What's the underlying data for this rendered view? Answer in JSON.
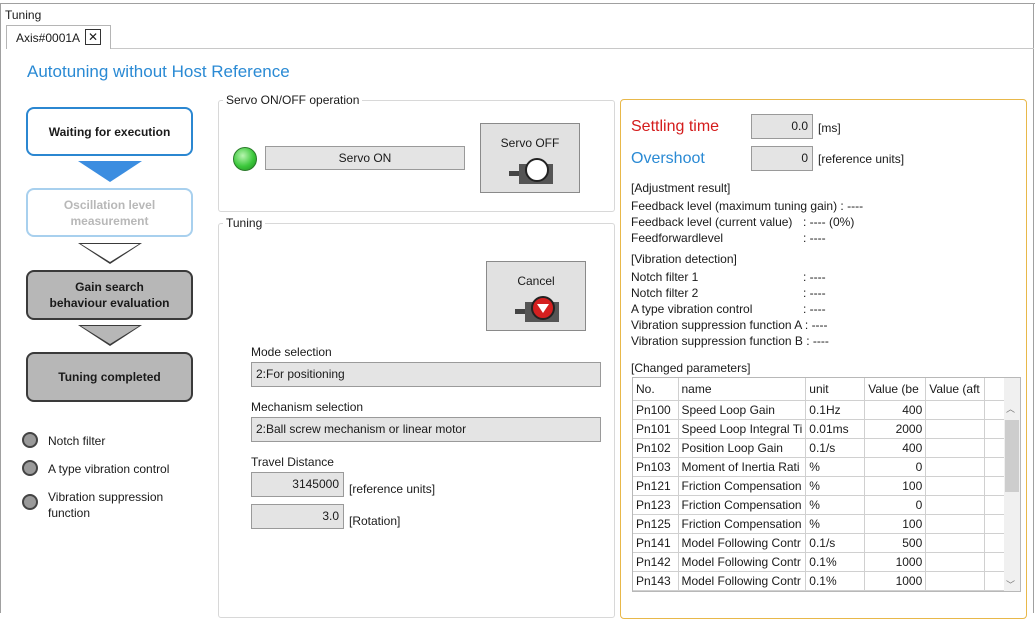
{
  "window": {
    "title": "Tuning",
    "tab_label": "Axis#0001A",
    "tab_close": "✕"
  },
  "page_title": "Autotuning without Host Reference",
  "flow": {
    "steps": [
      "Waiting for execution",
      "Oscillation level\nmeasurement",
      "Gain search\nbehaviour evaluation",
      "Tuning completed"
    ]
  },
  "legend": [
    "Notch filter",
    "A type vibration control",
    "Vibration suppression\nfunction"
  ],
  "servo": {
    "group_label": "Servo ON/OFF operation",
    "status": "Servo ON",
    "status_color": "#3cc83c",
    "button_label": "Servo OFF"
  },
  "tuning": {
    "group_label": "Tuning",
    "cancel_label": "Cancel",
    "mode_label": "Mode selection",
    "mode_value": "2:For positioning",
    "mechanism_label": "Mechanism selection",
    "mechanism_value": "2:Ball screw mechanism or linear motor",
    "travel_label": "Travel Distance",
    "travel_value": "3145000",
    "travel_unit": "[reference units]",
    "rotation_value": "3.0",
    "rotation_unit": "[Rotation]"
  },
  "result": {
    "settling_label": "Settling time",
    "settling_value": "0.0",
    "settling_unit": "[ms]",
    "overshoot_label": "Overshoot",
    "overshoot_value": "0",
    "overshoot_unit": "[reference units]",
    "adjustment_heading": "[Adjustment result]",
    "adjustment_lines": [
      "Feedback level (maximum tuning gain) : ----",
      "Feedback level (current value)     : ---- (0%)",
      "Feedforwardlevel                   : ----"
    ],
    "vibration_heading": "[Vibration detection]",
    "vibration_lines": [
      "Notch filter 1                    : ----",
      "Notch filter 2                    : ----",
      "A type vibration control          : ----",
      "Vibration suppression function A : ----",
      "Vibration suppression function B : ----"
    ],
    "changed_heading": "[Changed parameters]"
  },
  "table": {
    "headers": [
      "No.",
      "name",
      "unit",
      "Value (be",
      "Value (aft",
      ""
    ],
    "rows": [
      [
        "Pn100",
        "Speed Loop Gain",
        "0.1Hz",
        "400",
        "",
        ""
      ],
      [
        "Pn101",
        "Speed Loop Integral Ti",
        "0.01ms",
        "2000",
        "",
        ""
      ],
      [
        "Pn102",
        "Position Loop Gain",
        "0.1/s",
        "400",
        "",
        ""
      ],
      [
        "Pn103",
        "Moment of Inertia Rati",
        "%",
        "0",
        "",
        ""
      ],
      [
        "Pn121",
        "Friction Compensation",
        "%",
        "100",
        "",
        ""
      ],
      [
        "Pn123",
        "Friction Compensation",
        "%",
        "0",
        "",
        ""
      ],
      [
        "Pn125",
        "Friction Compensation",
        "%",
        "100",
        "",
        ""
      ],
      [
        "Pn141",
        "Model Following Contr",
        "0.1/s",
        "500",
        "",
        ""
      ],
      [
        "Pn142",
        "Model Following Contr",
        "0.1%",
        "1000",
        "",
        ""
      ],
      [
        "Pn143",
        "Model Following Contr",
        "0.1%",
        "1000",
        "",
        ""
      ]
    ]
  }
}
